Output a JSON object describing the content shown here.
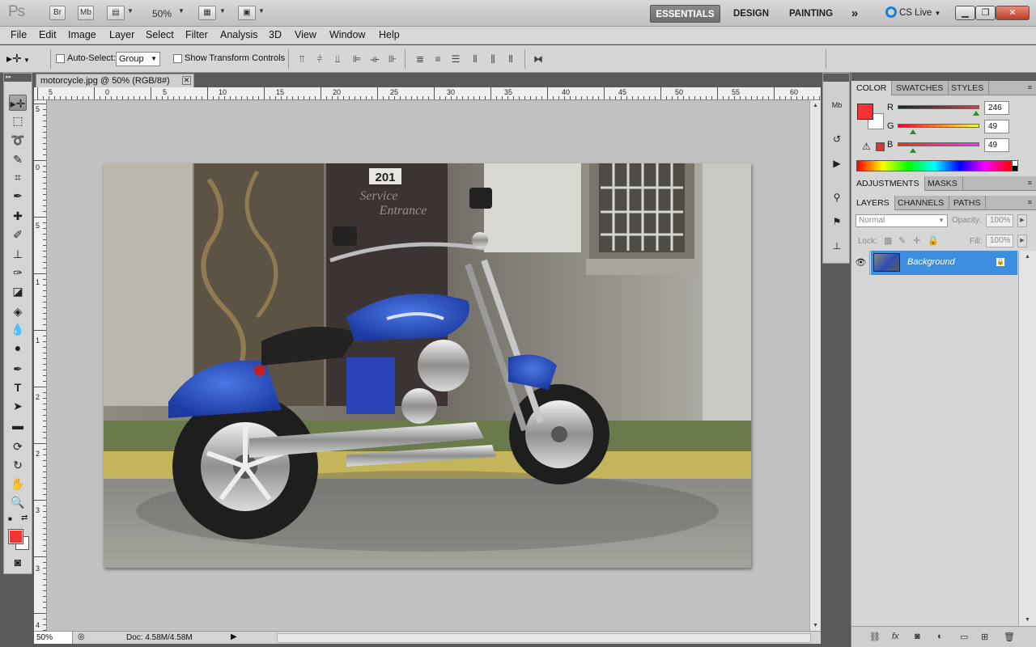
{
  "appbar": {
    "logo": "Ps",
    "bridge_label": "Br",
    "minibridge_label": "Mb",
    "zoom": "50%",
    "workspaces": [
      "ESSENTIALS",
      "DESIGN",
      "PAINTING"
    ],
    "more_label": "»",
    "cs_live": "CS Live",
    "window_controls": [
      "minimize-icon",
      "restore-icon",
      "close-icon"
    ]
  },
  "menubar": [
    "File",
    "Edit",
    "Image",
    "Layer",
    "Select",
    "Filter",
    "Analysis",
    "3D",
    "View",
    "Window",
    "Help"
  ],
  "options": {
    "auto_select": "Auto-Select:",
    "auto_select_value": "Group",
    "show_transform": "Show Transform Controls"
  },
  "document": {
    "tab_title": "motorcycle.jpg @ 50% (RGB/8#)",
    "status_zoom": "50%",
    "status_doc": "Doc: 4.58M/4.58M",
    "ruler_top": [
      "5",
      "0",
      "5",
      "10",
      "15",
      "20",
      "25",
      "30",
      "35",
      "40",
      "45",
      "50",
      "55",
      "60"
    ],
    "ruler_left": [
      "5",
      "0",
      "5",
      "1",
      "1",
      "2",
      "2",
      "3",
      "3",
      "4"
    ],
    "photo": {
      "door_number": "201",
      "door_text_1": "Service",
      "door_text_2": "Entrance"
    }
  },
  "color_panel": {
    "tabs": [
      "COLOR",
      "SWATCHES",
      "STYLES"
    ],
    "r_label": "R",
    "g_label": "G",
    "b_label": "B",
    "r": 246,
    "g": 49,
    "b": 49,
    "r_text": "246",
    "g_text": "49",
    "b_text": "49",
    "fg_color": "#f63131",
    "bg_color": "#ffffff"
  },
  "adjustments_panel": {
    "tabs": [
      "ADJUSTMENTS",
      "MASKS"
    ]
  },
  "layers_panel": {
    "tabs": [
      "LAYERS",
      "CHANNELS",
      "PATHS"
    ],
    "blend_mode": "Normal",
    "opacity_label": "Opacity:",
    "opacity": "100%",
    "lock_label": "Lock:",
    "fill_label": "Fill:",
    "fill": "100%",
    "layers": [
      {
        "name": "Background"
      }
    ]
  }
}
